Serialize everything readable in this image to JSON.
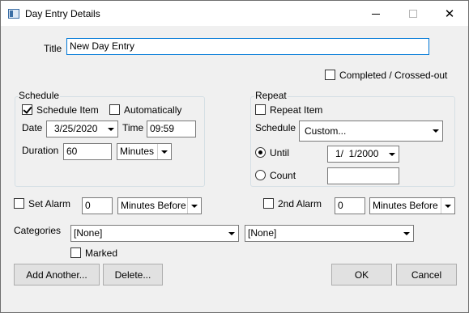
{
  "window": {
    "title": "Day Entry Details",
    "minimize_glyph": "",
    "maximize_glyph": "",
    "close_glyph": "✕"
  },
  "title_field": {
    "label": "Title",
    "value": "New Day Entry"
  },
  "completed": {
    "label": "Completed / Crossed-out",
    "checked": false
  },
  "schedule_group": {
    "title": "Schedule",
    "schedule_item": {
      "label": "Schedule Item",
      "checked": true
    },
    "automatically": {
      "label": "Automatically",
      "checked": false
    },
    "date": {
      "label": "Date",
      "value": "3/25/2020"
    },
    "time": {
      "label": "Time",
      "value": "09:59"
    },
    "duration": {
      "label": "Duration",
      "value": "60",
      "unit": "Minutes"
    }
  },
  "repeat_group": {
    "title": "Repeat",
    "repeat_item": {
      "label": "Repeat Item",
      "checked": false
    },
    "schedule": {
      "label": "Schedule",
      "value": "Custom..."
    },
    "until": {
      "label": "Until",
      "value": "1/  1/2000",
      "selected": true
    },
    "count": {
      "label": "Count",
      "value": "",
      "selected": false
    }
  },
  "set_alarm": {
    "label": "Set Alarm",
    "checked": false,
    "value": "0",
    "unit": "Minutes Before"
  },
  "second_alarm": {
    "label": "2nd Alarm",
    "checked": false,
    "value": "0",
    "unit": "Minutes Before"
  },
  "categories": {
    "label": "Categories",
    "first": "[None]",
    "second": "[None]"
  },
  "marked": {
    "label": "Marked",
    "checked": false
  },
  "buttons": {
    "add_another": "Add Another...",
    "delete": "Delete...",
    "ok": "OK",
    "cancel": "Cancel"
  }
}
